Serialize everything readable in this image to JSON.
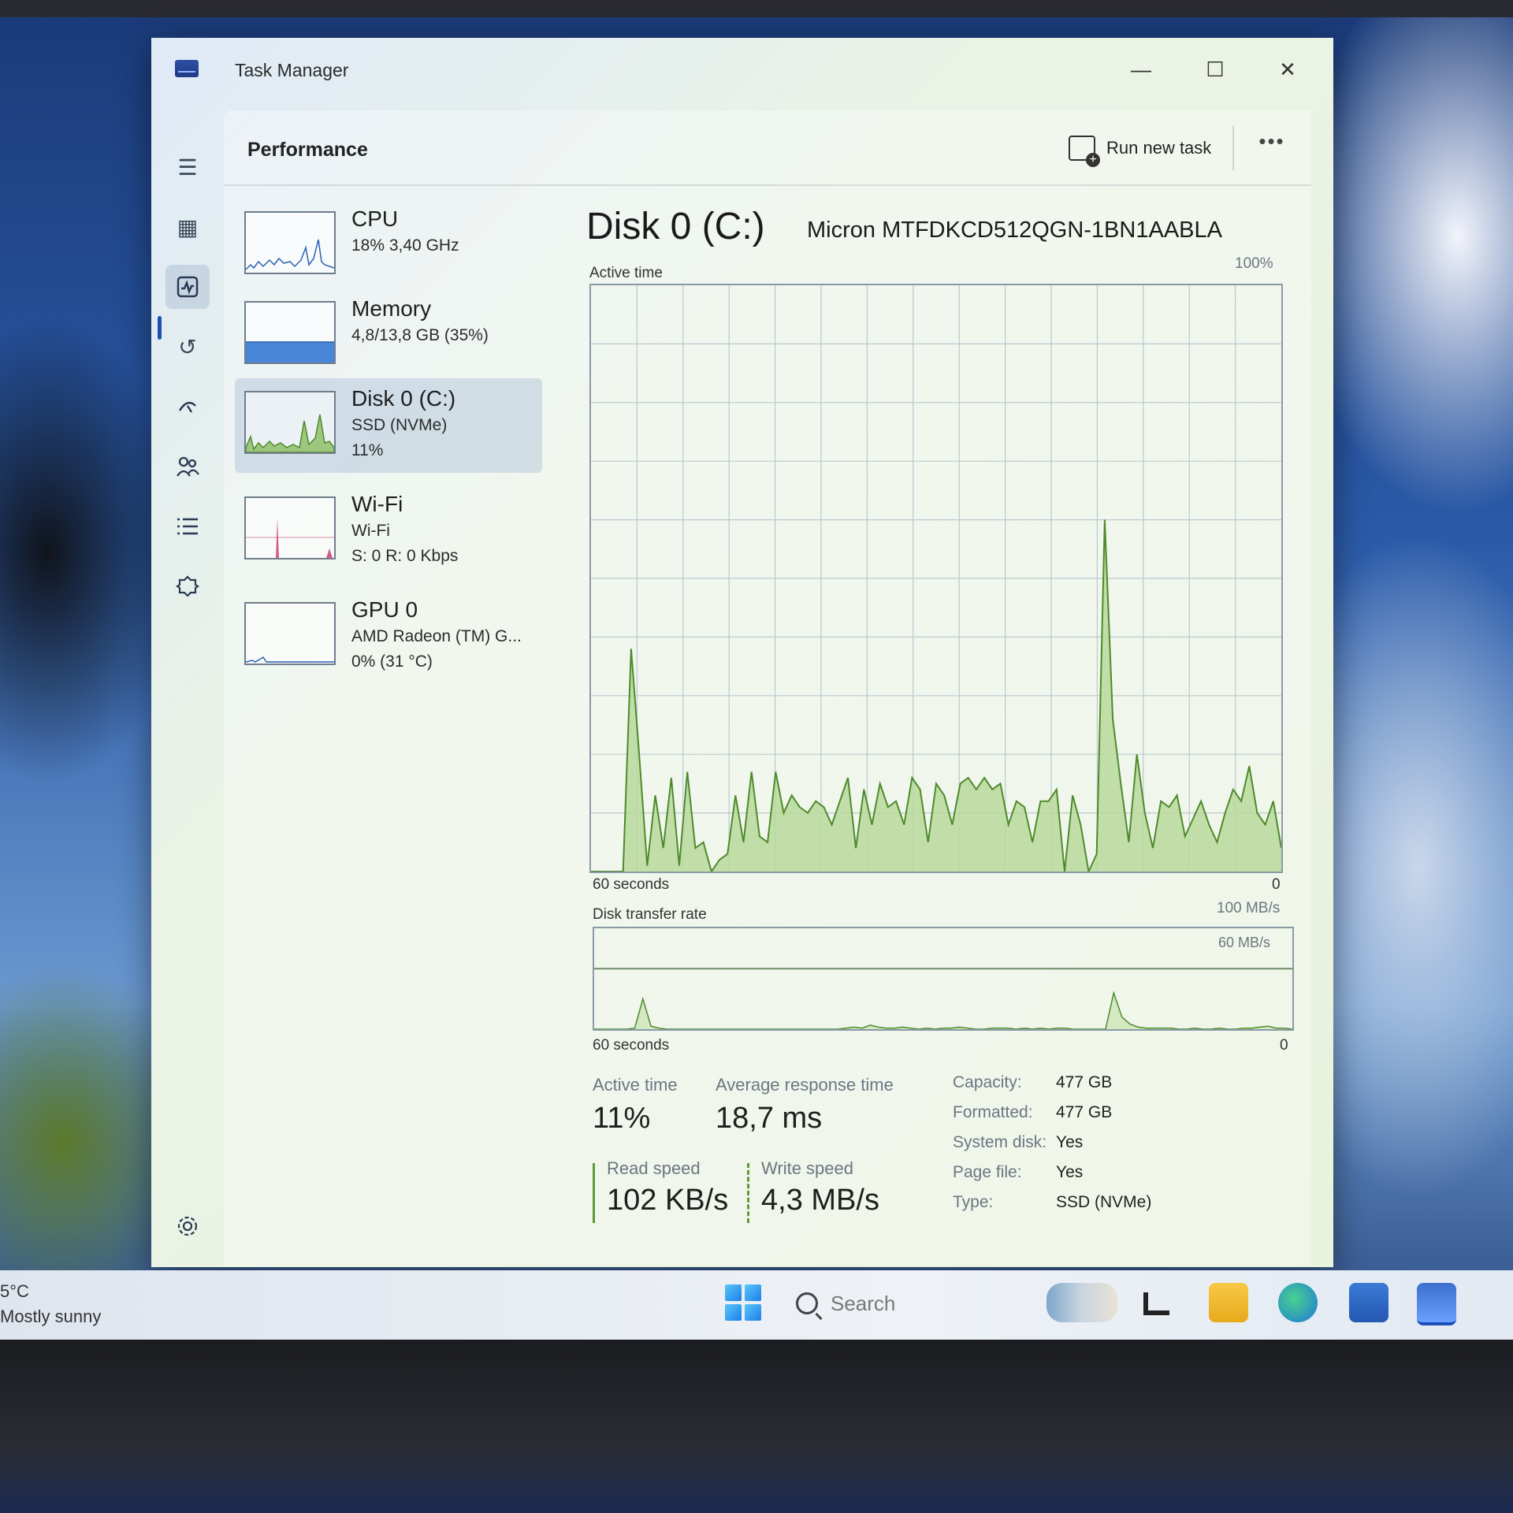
{
  "window": {
    "title": "Task Manager",
    "controls": {
      "minimize": "—",
      "maximize": "☐",
      "close": "✕"
    }
  },
  "header": {
    "page_title": "Performance",
    "run_new_task": "Run new task",
    "more": "•••"
  },
  "sidebar": {
    "items": [
      {
        "icon": "hamburger-menu-icon",
        "glyph": "☰"
      },
      {
        "icon": "processes-icon",
        "glyph": "▦"
      },
      {
        "icon": "performance-icon",
        "glyph": "⌁",
        "active": true
      },
      {
        "icon": "app-history-icon",
        "glyph": "↺"
      },
      {
        "icon": "startup-apps-icon",
        "glyph": "⚲"
      },
      {
        "icon": "users-icon",
        "glyph": "👥"
      },
      {
        "icon": "details-icon",
        "glyph": "☰"
      },
      {
        "icon": "services-icon",
        "glyph": "⚙"
      }
    ],
    "settings_icon": "⚙"
  },
  "devices": [
    {
      "name": "CPU",
      "line1": "18%  3,40 GHz",
      "line2": "",
      "color": "#2b5fb4",
      "selected": false
    },
    {
      "name": "Memory",
      "line1": "4,8/13,8 GB (35%)",
      "line2": "",
      "color": "#2b5fb4",
      "selected": false
    },
    {
      "name": "Disk 0 (C:)",
      "line1": "SSD (NVMe)",
      "line2": "11%",
      "color": "#4e8a2c",
      "selected": true
    },
    {
      "name": "Wi-Fi",
      "line1": "Wi-Fi",
      "line2": "S: 0  R: 0 Kbps",
      "color": "#b0245a",
      "selected": false
    },
    {
      "name": "GPU 0",
      "line1": "AMD Radeon (TM) G...",
      "line2": "0%  (31 °C)",
      "color": "#2b5fb4",
      "selected": false
    }
  ],
  "disk": {
    "title": "Disk 0 (C:)",
    "model": "Micron MTFDKCD512QGN-1BN1AABLA",
    "active_time_label": "Active time",
    "active_time_max": "100%",
    "seconds_label": "60 seconds",
    "zero_label": "0",
    "transfer_label": "Disk transfer rate",
    "transfer_max": "100 MB/s",
    "transfer_mid": "60 MB/s",
    "transfer_seconds": "60 seconds",
    "transfer_zero": "0"
  },
  "stats": {
    "active_time": {
      "label": "Active time",
      "value": "11%"
    },
    "avg_response": {
      "label": "Average response time",
      "value": "18,7 ms"
    },
    "read_speed": {
      "label": "Read speed",
      "value": "102 KB/s"
    },
    "write_speed": {
      "label": "Write speed",
      "value": "4,3 MB/s"
    }
  },
  "properties": [
    {
      "label": "Capacity:",
      "value": "477 GB"
    },
    {
      "label": "Formatted:",
      "value": "477 GB"
    },
    {
      "label": "System disk:",
      "value": "Yes"
    },
    {
      "label": "Page file:",
      "value": "Yes"
    },
    {
      "label": "Type:",
      "value": "SSD (NVMe)"
    }
  ],
  "chart_data": [
    {
      "type": "area",
      "title": "Active time",
      "x_range": [
        60,
        0
      ],
      "ylim": [
        0,
        100
      ],
      "values": [
        0,
        0,
        0,
        0,
        0,
        38,
        20,
        1,
        13,
        4,
        16,
        1,
        17,
        4,
        5,
        0,
        2,
        3,
        13,
        5,
        17,
        6,
        5,
        17,
        10,
        13,
        11,
        10,
        12,
        11,
        8,
        12,
        16,
        4,
        14,
        8,
        15,
        11,
        12,
        8,
        16,
        14,
        5,
        15,
        13,
        8,
        15,
        16,
        14,
        16,
        14,
        15,
        8,
        12,
        11,
        5,
        12,
        12,
        14,
        0,
        13,
        8,
        0,
        3,
        60,
        26,
        15,
        5,
        20,
        10,
        4,
        12,
        11,
        13,
        6,
        9,
        12,
        8,
        5,
        10,
        14,
        12,
        18,
        10,
        8,
        12,
        4
      ]
    },
    {
      "type": "line",
      "title": "Disk transfer rate",
      "x_range": [
        60,
        0
      ],
      "ylim": [
        0,
        100
      ],
      "series": [
        {
          "name": "Read speed",
          "values": [
            0,
            0,
            0,
            0,
            0,
            1,
            30,
            3,
            1,
            0,
            0,
            0,
            0,
            0,
            0,
            0,
            0,
            0,
            0,
            0,
            0,
            0,
            0,
            0,
            0,
            0,
            0,
            0,
            0,
            0,
            0,
            1,
            2,
            1,
            4,
            2,
            1,
            1,
            2,
            1,
            0,
            1,
            0,
            1,
            1,
            2,
            1,
            0,
            0,
            1,
            1,
            1,
            0,
            1,
            0,
            1,
            0,
            1,
            1,
            0,
            0,
            0,
            0,
            0,
            36,
            12,
            5,
            2,
            1,
            1,
            1,
            1,
            0,
            0,
            1,
            0,
            0,
            1,
            0,
            0,
            1,
            1,
            2,
            3,
            1,
            1,
            0
          ]
        }
      ]
    }
  ],
  "taskbar": {
    "weather_temp": "5°C",
    "weather_desc": "Mostly sunny",
    "search_placeholder": "Search"
  }
}
